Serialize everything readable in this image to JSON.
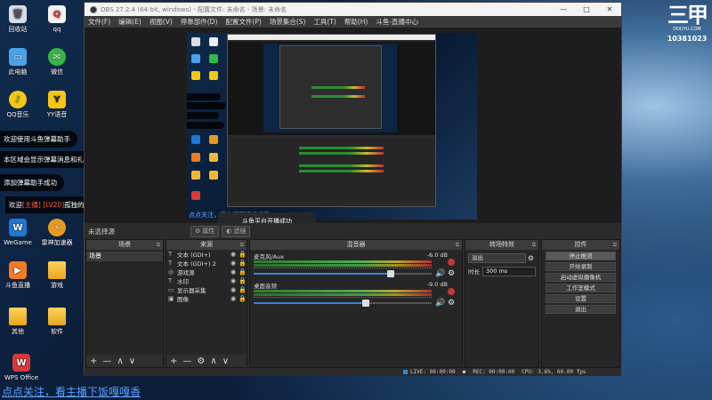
{
  "desktop": {
    "icons": [
      {
        "label": "回收站",
        "glyph": "🗑",
        "color": "#d8dde6"
      },
      {
        "label": "qq",
        "glyph": "Q",
        "color": "#f2f2f2"
      },
      {
        "label": "此电脑",
        "glyph": "▭",
        "color": "#4aa3e8"
      },
      {
        "label": "微信",
        "glyph": "✉",
        "color": "#34b745"
      },
      {
        "label": "QQ音乐",
        "glyph": "♪",
        "color": "#f5c518"
      },
      {
        "label": "YY语音",
        "glyph": "Y",
        "color": "#f5c518"
      },
      {
        "label": "WeGame",
        "glyph": "W",
        "color": "#1f78d1"
      },
      {
        "label": "雷神加速器",
        "glyph": "⚡",
        "color": "#e89a20"
      },
      {
        "label": "斗鱼直播",
        "glyph": "▶",
        "color": "#f07c24"
      },
      {
        "label": "游戏",
        "glyph": "",
        "color": "#f3b735"
      },
      {
        "label": "其他",
        "glyph": "",
        "color": "#f3b735"
      },
      {
        "label": "软件",
        "glyph": "",
        "color": "#f3b735"
      },
      {
        "label": "WPS Office",
        "glyph": "W",
        "color": "#d63a3a"
      }
    ],
    "notices": [
      {
        "text": "欢迎使用斗鱼弹幕助手"
      },
      {
        "text": "本区域会显示弹幕消息和礼物消息"
      },
      {
        "text": "添加弹幕助手成功"
      },
      {
        "pre": "欢迎",
        "name": "[主播] [LV20]",
        "post": "孤独的心进入直播间"
      }
    ],
    "logo": {
      "sub": "DOUYU.COM",
      "room_id": "10381023"
    },
    "bottom_caption": "点点关注，看主播下饭嘎嘎香"
  },
  "obs": {
    "title": "OBS 27.2.4 (64-bit, windows) - 配置文件: 未命名 - 场景: 未命名",
    "window_buttons": [
      "—",
      "□",
      "✕"
    ],
    "menu": [
      "文件(F)",
      "编辑(E)",
      "视图(V)",
      "停靠部件(D)",
      "配置文件(P)",
      "场景集合(S)",
      "工具(T)",
      "帮助(H)",
      "斗鱼-直播中心"
    ],
    "inner_toast": "斗鱼平台开播成功",
    "mini_caption": "点点关注，看主播下饭嘎嘎香",
    "scene_label": "未选择源",
    "props_label": "属性",
    "filters_label": "滤镜",
    "docks": {
      "scenes": {
        "title": "场景",
        "items": [
          "场景"
        ]
      },
      "sources": {
        "title": "来源",
        "items": [
          {
            "icon": "T",
            "name": "文本 (GDI+)"
          },
          {
            "icon": "T",
            "name": "文本 (GDI+) 2"
          },
          {
            "icon": "◎",
            "name": "游戏源"
          },
          {
            "icon": "T",
            "name": "水印"
          },
          {
            "icon": "▭",
            "name": "显示器采集"
          },
          {
            "icon": "▣",
            "name": "图像"
          }
        ]
      },
      "mixer": {
        "title": "混音器",
        "channels": [
          {
            "name": "麦克风/Aux",
            "db": "-6.0 dB",
            "level": 0.77
          },
          {
            "name": "桌面音频",
            "db": "-9.0 dB",
            "level": 0.63
          }
        ]
      },
      "transitions": {
        "title": "转场特效",
        "type": "淡出",
        "duration_label": "时长",
        "duration": "300 ms"
      },
      "controls": {
        "title": "控件",
        "buttons": [
          "停止推流",
          "开始录制",
          "启动虚拟摄像机",
          "工作室模式",
          "设置",
          "退出"
        ]
      }
    },
    "footer_buttons": {
      "add": "+",
      "remove": "—",
      "up": "∧",
      "down": "∨",
      "gear": "⚙"
    },
    "status": {
      "live": "LIVE: 00:00:00",
      "rec": "REC: 00:00:00",
      "cpu": "CPU: 3.6%, 60.00 fps"
    }
  }
}
